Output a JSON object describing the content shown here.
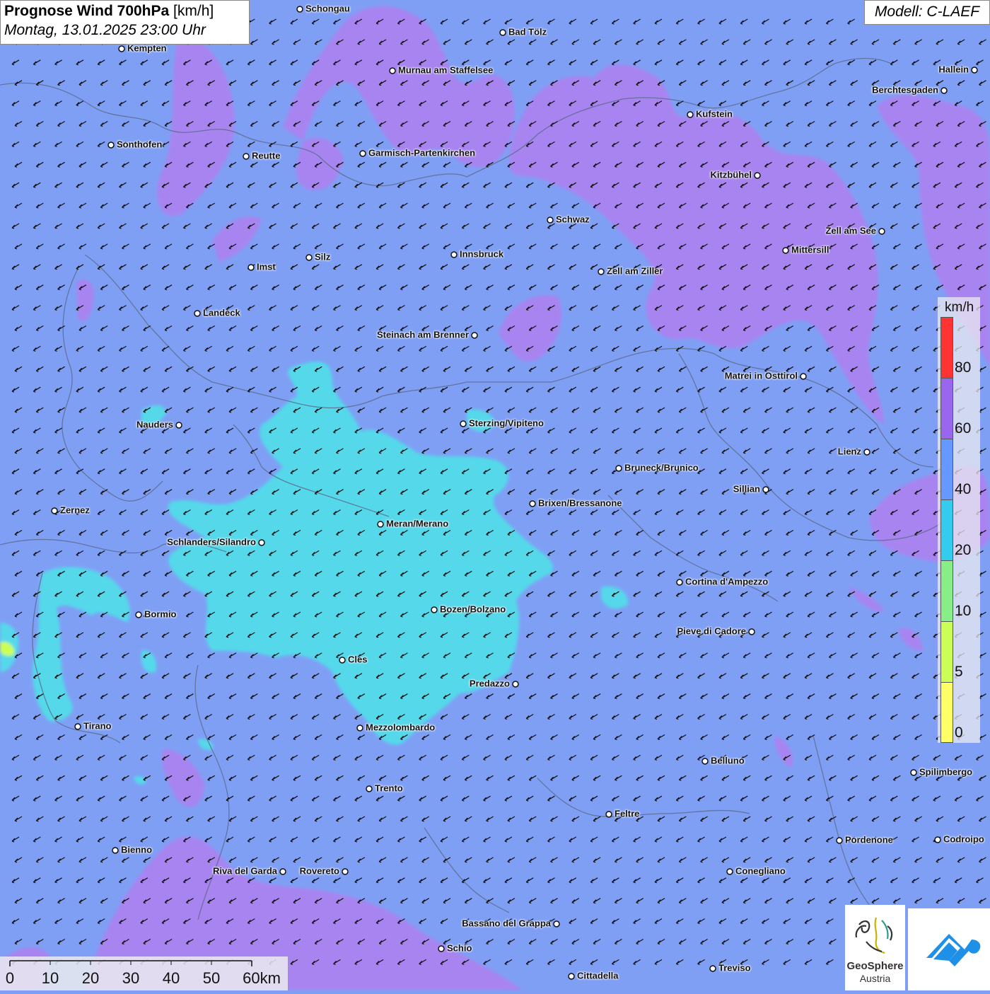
{
  "header": {
    "title_bold": "Prognose Wind 700hPa",
    "title_unit": " [km/h]",
    "subtitle": "Montag, 13.01.2025 23:00 Uhr",
    "model": "Modell: C-LAEF"
  },
  "colors": {
    "band_0_5": "#ffff66",
    "band_5_10": "#ccff55",
    "band_10_20": "#88ee88",
    "band_20_40": "#33ccee",
    "band_40_60": "#6699ff",
    "band_60_80": "#9966ee",
    "band_80_100": "#ff3333",
    "map_blue": "#7f9ff5",
    "map_cyan": "#55d8ea",
    "map_purple": "#a884f0"
  },
  "wind_direction": "from north-east, uniform",
  "cities": [
    {
      "name": "Schongau"
    },
    {
      "name": "Bad Tölz"
    },
    {
      "name": "Kempten"
    },
    {
      "name": "Murnau am Staffelsee"
    },
    {
      "name": "Hallein"
    },
    {
      "name": "Berchtesgaden"
    },
    {
      "name": "Kufstein"
    },
    {
      "name": "Sonthofen"
    },
    {
      "name": "Reutte"
    },
    {
      "name": "Garmisch-Partenkirchen"
    },
    {
      "name": "Kitzbühel"
    },
    {
      "name": "Schwaz"
    },
    {
      "name": "Zell am See"
    },
    {
      "name": "Mittersill"
    },
    {
      "name": "Imst"
    },
    {
      "name": "Silz"
    },
    {
      "name": "Innsbruck"
    },
    {
      "name": "Zell am Ziller"
    },
    {
      "name": "Landeck"
    },
    {
      "name": "Steinach am Brenner"
    },
    {
      "name": "Matrei in Osttirol"
    },
    {
      "name": "Nauders"
    },
    {
      "name": "Sterzing/Vipiteno"
    },
    {
      "name": "Lienz"
    },
    {
      "name": "Bruneck/Brunico"
    },
    {
      "name": "Sillian"
    },
    {
      "name": "Zernez"
    },
    {
      "name": "Brixen/Bressanone"
    },
    {
      "name": "Meran/Merano"
    },
    {
      "name": "Schlanders/Silandro"
    },
    {
      "name": "Cortina d'Ampezzo"
    },
    {
      "name": "Bozen/Bolzano"
    },
    {
      "name": "Bormio"
    },
    {
      "name": "Pieve di Cadore"
    },
    {
      "name": "Cles"
    },
    {
      "name": "Predazzo"
    },
    {
      "name": "Tirano"
    },
    {
      "name": "Mezzolombardo"
    },
    {
      "name": "Belluno"
    },
    {
      "name": "Spilimbergo"
    },
    {
      "name": "Trento"
    },
    {
      "name": "Feltre"
    },
    {
      "name": "Bienno"
    },
    {
      "name": "Pordenone"
    },
    {
      "name": "Codroipo"
    },
    {
      "name": "Riva del Garda"
    },
    {
      "name": "Rovereto"
    },
    {
      "name": "Conegliano"
    },
    {
      "name": "Bassano del Grappa"
    },
    {
      "name": "Schio"
    },
    {
      "name": "Treviso"
    },
    {
      "name": "Cittadella"
    }
  ],
  "legend": {
    "unit": "km/h",
    "labels": [
      "80",
      "60",
      "40",
      "20",
      "10",
      "5",
      "0"
    ]
  },
  "scale_bar": {
    "labels": [
      "0",
      "10",
      "20",
      "30",
      "40",
      "50",
      "60km"
    ]
  },
  "logos": {
    "geosphere_line1": "GeoSphere",
    "geosphere_line2": "Austria"
  }
}
